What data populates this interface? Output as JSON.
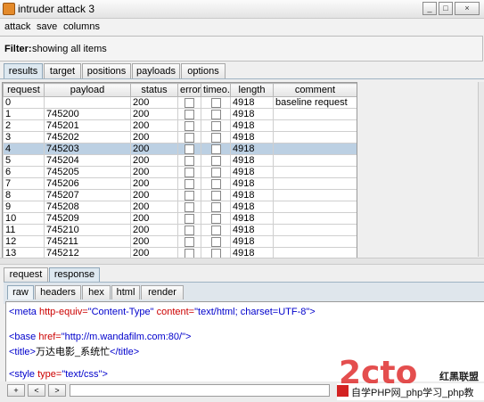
{
  "window": {
    "title": "intruder attack 3",
    "min_label": "_",
    "max_label": "□",
    "close_label": "×"
  },
  "menu": [
    "attack",
    "save",
    "columns"
  ],
  "filter": {
    "label": "Filter:",
    "value": "showing all items"
  },
  "tabs": [
    "results",
    "target",
    "positions",
    "payloads",
    "options"
  ],
  "table": {
    "columns": [
      "request",
      "payload",
      "status",
      "error",
      "timeo...",
      "length",
      "comment"
    ],
    "rows": [
      {
        "request": "0",
        "payload": "",
        "status": "200",
        "length": "4918",
        "comment": "baseline request"
      },
      {
        "request": "1",
        "payload": "745200",
        "status": "200",
        "length": "4918",
        "comment": ""
      },
      {
        "request": "2",
        "payload": "745201",
        "status": "200",
        "length": "4918",
        "comment": ""
      },
      {
        "request": "3",
        "payload": "745202",
        "status": "200",
        "length": "4918",
        "comment": ""
      },
      {
        "request": "4",
        "payload": "745203",
        "status": "200",
        "length": "4918",
        "comment": ""
      },
      {
        "request": "5",
        "payload": "745204",
        "status": "200",
        "length": "4918",
        "comment": ""
      },
      {
        "request": "6",
        "payload": "745205",
        "status": "200",
        "length": "4918",
        "comment": ""
      },
      {
        "request": "7",
        "payload": "745206",
        "status": "200",
        "length": "4918",
        "comment": ""
      },
      {
        "request": "8",
        "payload": "745207",
        "status": "200",
        "length": "4918",
        "comment": ""
      },
      {
        "request": "9",
        "payload": "745208",
        "status": "200",
        "length": "4918",
        "comment": ""
      },
      {
        "request": "10",
        "payload": "745209",
        "status": "200",
        "length": "4918",
        "comment": ""
      },
      {
        "request": "11",
        "payload": "745210",
        "status": "200",
        "length": "4918",
        "comment": ""
      },
      {
        "request": "12",
        "payload": "745211",
        "status": "200",
        "length": "4918",
        "comment": ""
      },
      {
        "request": "13",
        "payload": "745212",
        "status": "200",
        "length": "4918",
        "comment": ""
      }
    ],
    "selected_request": "4"
  },
  "bottom_tabs": [
    "request",
    "response"
  ],
  "view_tabs": [
    "raw",
    "headers",
    "hex",
    "html",
    "render"
  ],
  "code": {
    "l1": {
      "open": "<meta",
      "a1": " http-equiv=",
      "v1": "\"Content-Type\"",
      "a2": " content=",
      "v2": "\"text/html; charset=UTF-8\"",
      "close": ">"
    },
    "l2": {
      "open": "<base",
      "a1": " href=",
      "v1": "\"http://m.wandafilm.com:80/\"",
      "close": ">"
    },
    "l3": {
      "open": "<title>",
      "text": "万达电影_系统忙",
      "close": "</title>"
    },
    "l4": {
      "open": "<style",
      "a1": " type=",
      "v1": "\"text/css\"",
      "close": ">"
    }
  },
  "nav_buttons": [
    "+",
    "<",
    ">"
  ],
  "watermark": {
    "big": "2cto",
    "cn": "红黑联盟",
    "bar": "自学PHP网_php学习_php教"
  }
}
